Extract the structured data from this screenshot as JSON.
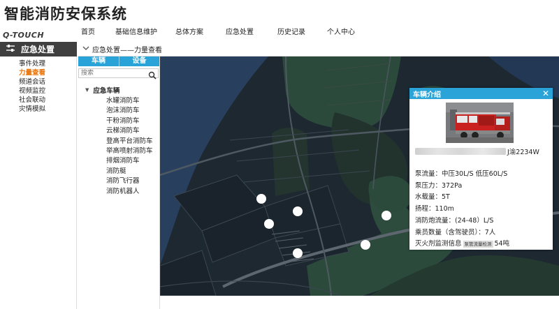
{
  "app_title": "智能消防安保系统",
  "logo": {
    "text": "Q-TOUCH"
  },
  "top_nav": [
    "首页",
    "基础信息维护",
    "总体方案",
    "应急处置",
    "历史记录",
    "个人中心"
  ],
  "sidebar": {
    "title": "应急处置",
    "items": [
      {
        "label": "事件处理",
        "active": false
      },
      {
        "label": "力量查看",
        "active": true
      },
      {
        "label": "频道会话",
        "active": false
      },
      {
        "label": "视频监控",
        "active": false
      },
      {
        "label": "社会联动",
        "active": false
      },
      {
        "label": "灾情模拟",
        "active": false
      }
    ]
  },
  "breadcrumb": "应急处置——力量查看",
  "panel": {
    "tabs": [
      "车辆",
      "设备"
    ],
    "search_placeholder": "搜索",
    "tree_root": "应急车辆",
    "tree_items": [
      "水罐消防车",
      "泡沫消防车",
      "干粉消防车",
      "云梯消防车",
      "登高平台消防车",
      "举高喷射消防车",
      "排烟消防车",
      "消防艇",
      "消防飞行器",
      "消防机器人"
    ]
  },
  "popup": {
    "title": "车辆介绍",
    "close": "✕",
    "plate": "J渝2234W",
    "specs": [
      {
        "label": "泵流量：",
        "value": "中压30L/S  低压60L/S"
      },
      {
        "label": "泵压力：",
        "value": "372Pa"
      },
      {
        "label": "水载量：",
        "value": "5T"
      },
      {
        "label": "扬程：",
        "value": "110m"
      },
      {
        "label": "消防炮流量：",
        "value": "(24-48）L/S"
      },
      {
        "label": "乘员数量（含驾驶员）：",
        "value": "7人"
      },
      {
        "label": "灭火剂监测信息",
        "tag": "泵管流量检测",
        "value": "54吨"
      }
    ]
  },
  "colors": {
    "accent": "#2aa4d8",
    "active": "#e8740c",
    "sidebar_header": "#3f3f3f",
    "map_bg": "#1d2831"
  }
}
